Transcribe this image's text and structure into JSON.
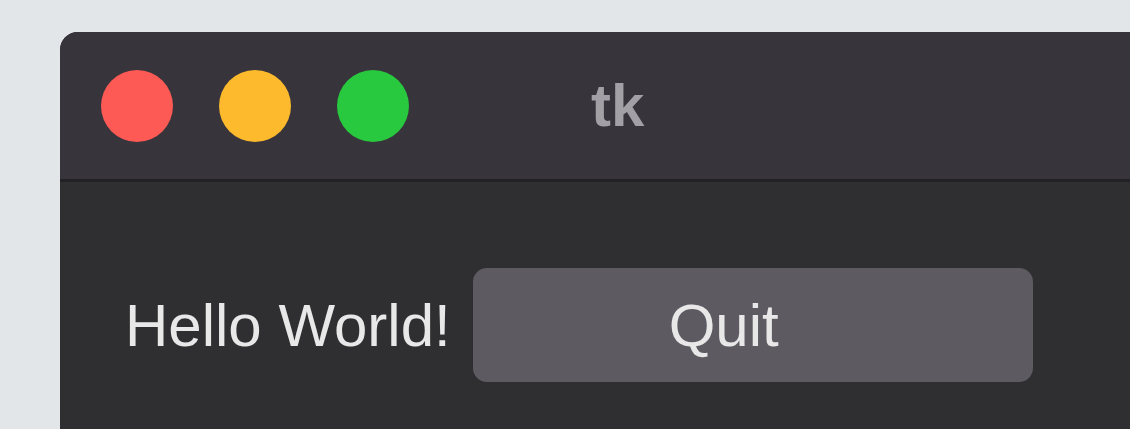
{
  "window": {
    "title": "tk"
  },
  "label": "Hello World!",
  "button": {
    "label": "Quit"
  }
}
